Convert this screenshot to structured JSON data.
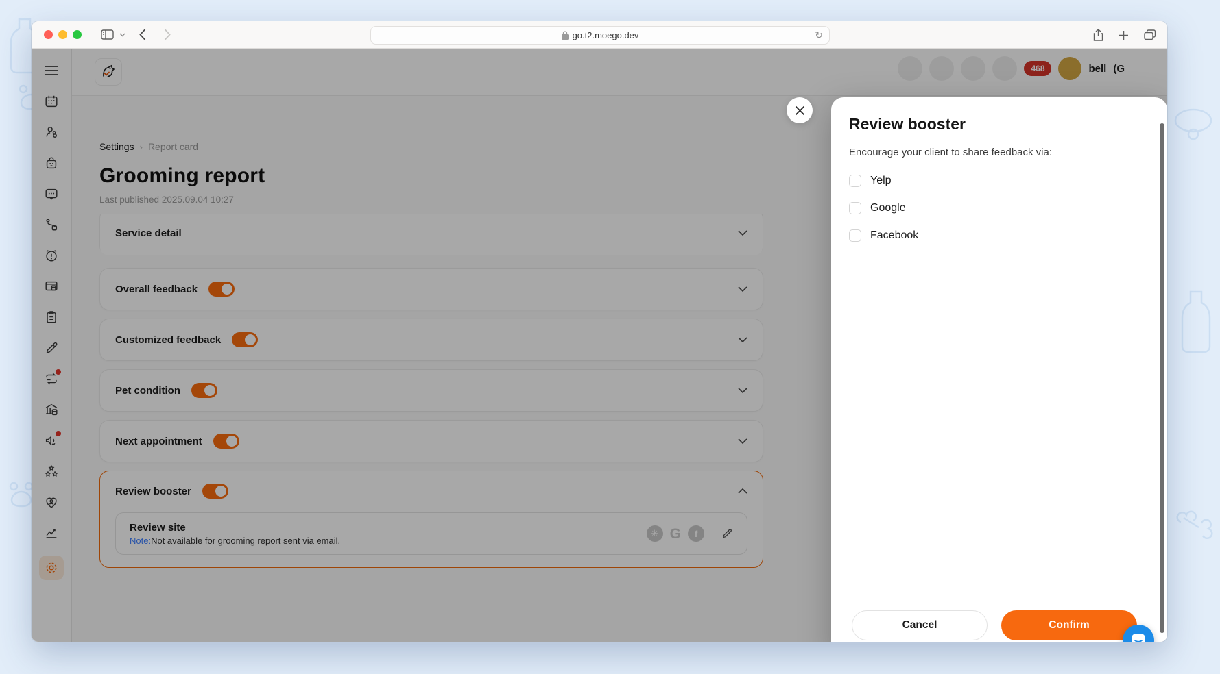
{
  "browser": {
    "url": "go.t2.moego.dev",
    "reload_glyph": "↻"
  },
  "sidebar": {
    "items": [
      {
        "icon": "menu-icon"
      },
      {
        "icon": "calendar-icon"
      },
      {
        "icon": "clients-icon"
      },
      {
        "icon": "bag-icon"
      },
      {
        "icon": "message-icon"
      },
      {
        "icon": "route-icon"
      },
      {
        "icon": "alarm-icon"
      },
      {
        "icon": "pos-icon"
      },
      {
        "icon": "clipboard-icon"
      },
      {
        "icon": "pen-icon"
      },
      {
        "icon": "retention-icon",
        "badge": true
      },
      {
        "icon": "bank-icon"
      },
      {
        "icon": "megaphone-icon",
        "badge": true
      },
      {
        "icon": "reviews-icon"
      },
      {
        "icon": "care-icon"
      },
      {
        "icon": "analytics-icon"
      },
      {
        "icon": "settings-icon",
        "active": true
      }
    ]
  },
  "header": {
    "notification_count": "468",
    "user_fragment": "bell",
    "user_paren_fragment": "(G"
  },
  "breadcrumb": {
    "first": "Settings",
    "separator": "›",
    "second": "Report card"
  },
  "page": {
    "title": "Grooming report",
    "last_published": "Last published 2025.09.04 10:27"
  },
  "sections": [
    {
      "label": "Service detail",
      "toggle": null,
      "expanded": false
    },
    {
      "label": "Overall feedback",
      "toggle": "on",
      "expanded": false
    },
    {
      "label": "Customized feedback",
      "toggle": "on",
      "expanded": false
    },
    {
      "label": "Pet condition",
      "toggle": "on",
      "expanded": false
    },
    {
      "label": "Next appointment",
      "toggle": "on",
      "expanded": false
    },
    {
      "label": "Review booster",
      "toggle": "on",
      "expanded": true
    }
  ],
  "review_site": {
    "title": "Review site",
    "note_label": "Note:",
    "note_text": "Not available for grooming report sent via email.",
    "platforms": [
      "yelp",
      "google",
      "facebook"
    ],
    "yelp_glyph": "✳",
    "google_glyph": "G",
    "facebook_glyph": "f"
  },
  "modal": {
    "title": "Review booster",
    "description": "Encourage your client to share feedback via:",
    "options": [
      {
        "label": "Yelp",
        "checked": false
      },
      {
        "label": "Google",
        "checked": false
      },
      {
        "label": "Facebook",
        "checked": false
      }
    ],
    "cancel_label": "Cancel",
    "confirm_label": "Confirm"
  },
  "colors": {
    "accent_orange": "#F7690F",
    "toggle_orange": "#F96C0F",
    "note_blue": "#3D7EFF",
    "badge_red": "#D7342A",
    "intercom_blue": "#1C8BE8",
    "dim_overlay": "rgba(0,0,0,0.34)"
  }
}
